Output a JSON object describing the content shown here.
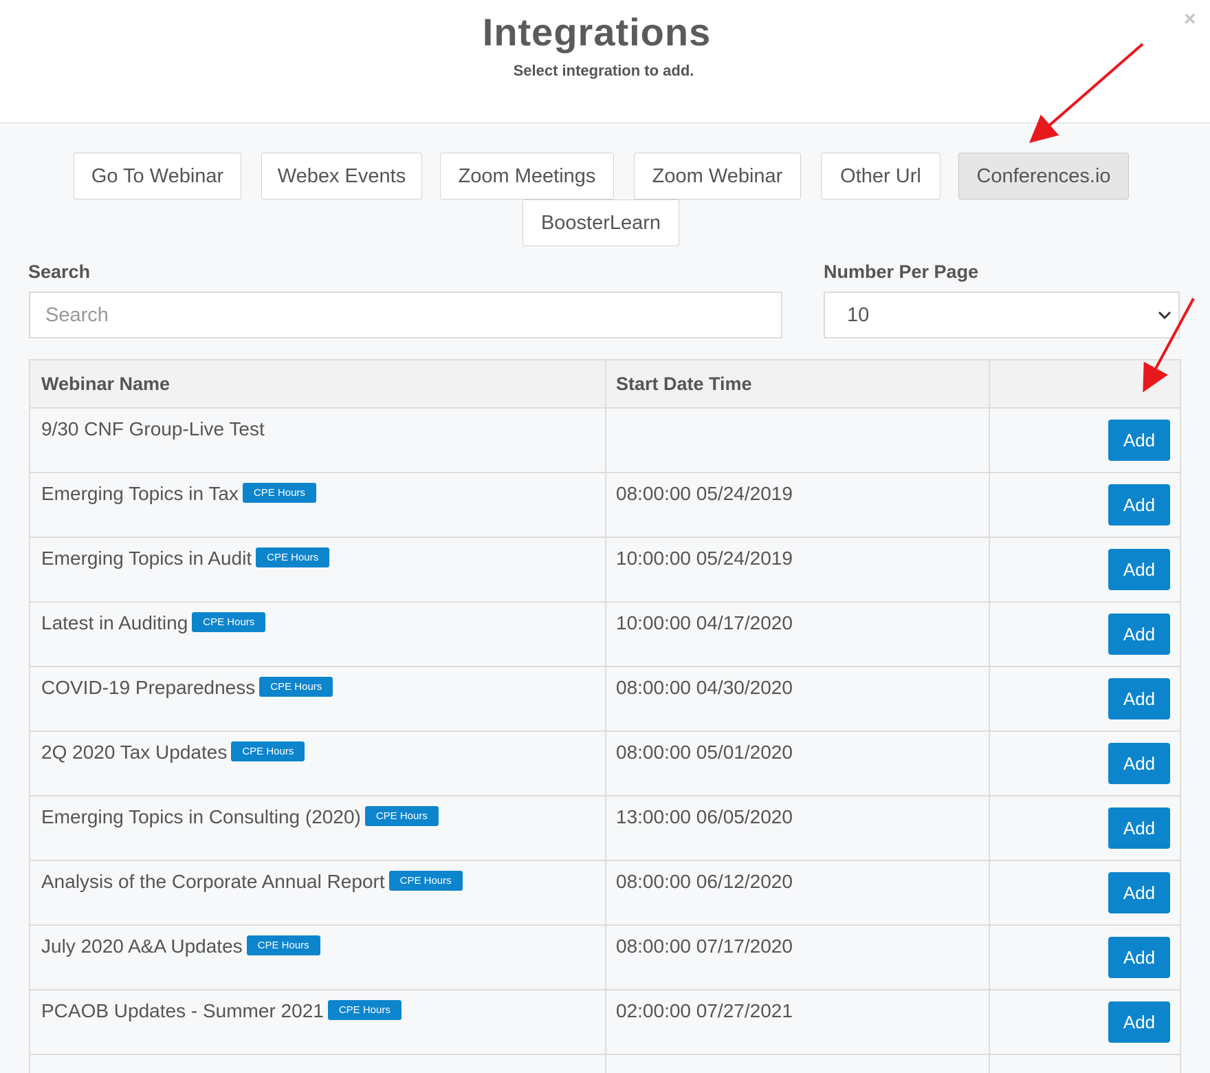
{
  "header": {
    "title": "Integrations",
    "subtitle": "Select integration to add.",
    "close_icon": "×"
  },
  "integrations": [
    {
      "label": "Go To Webinar",
      "active": false
    },
    {
      "label": "Webex Events",
      "active": false
    },
    {
      "label": "Zoom Meetings",
      "active": false
    },
    {
      "label": "Zoom Webinar",
      "active": false
    },
    {
      "label": "Other Url",
      "active": false
    },
    {
      "label": "Conferences.io",
      "active": true
    },
    {
      "label": "BoosterLearn",
      "active": false
    }
  ],
  "search": {
    "label": "Search",
    "placeholder": "Search",
    "value": ""
  },
  "per_page": {
    "label": "Number Per Page",
    "value": "10"
  },
  "table": {
    "columns": [
      "Webinar Name",
      "Start Date Time",
      ""
    ],
    "rows": [
      {
        "name": "9/30 CNF Group-Live Test",
        "badge": "",
        "date": "",
        "action": "Add"
      },
      {
        "name": "Emerging Topics in Tax",
        "badge": "CPE Hours",
        "date": "08:00:00 05/24/2019",
        "action": "Add"
      },
      {
        "name": "Emerging Topics in Audit",
        "badge": "CPE Hours",
        "date": "10:00:00 05/24/2019",
        "action": "Add"
      },
      {
        "name": "Latest in Auditing",
        "badge": "CPE Hours",
        "date": "10:00:00 04/17/2020",
        "action": "Add"
      },
      {
        "name": "COVID-19 Preparedness",
        "badge": "CPE Hours",
        "date": "08:00:00 04/30/2020",
        "action": "Add"
      },
      {
        "name": "2Q 2020 Tax Updates",
        "badge": "CPE Hours",
        "date": "08:00:00 05/01/2020",
        "action": "Add"
      },
      {
        "name": "Emerging Topics in Consulting (2020)",
        "badge": "CPE Hours",
        "date": "13:00:00 06/05/2020",
        "action": "Add"
      },
      {
        "name": "Analysis of the Corporate Annual Report",
        "badge": "CPE Hours",
        "date": "08:00:00 06/12/2020",
        "action": "Add"
      },
      {
        "name": "July 2020 A&A Updates",
        "badge": "CPE Hours",
        "date": "08:00:00 07/17/2020",
        "action": "Add"
      },
      {
        "name": "PCAOB Updates - Summer 2021",
        "badge": "CPE Hours",
        "date": "02:00:00 07/27/2021",
        "action": "Add"
      }
    ]
  },
  "colors": {
    "accent": "#0d85cd",
    "annotation_arrow": "#e8191c"
  },
  "icons": {
    "close": "close-icon",
    "select_chevron": "chevron-down-icon"
  }
}
